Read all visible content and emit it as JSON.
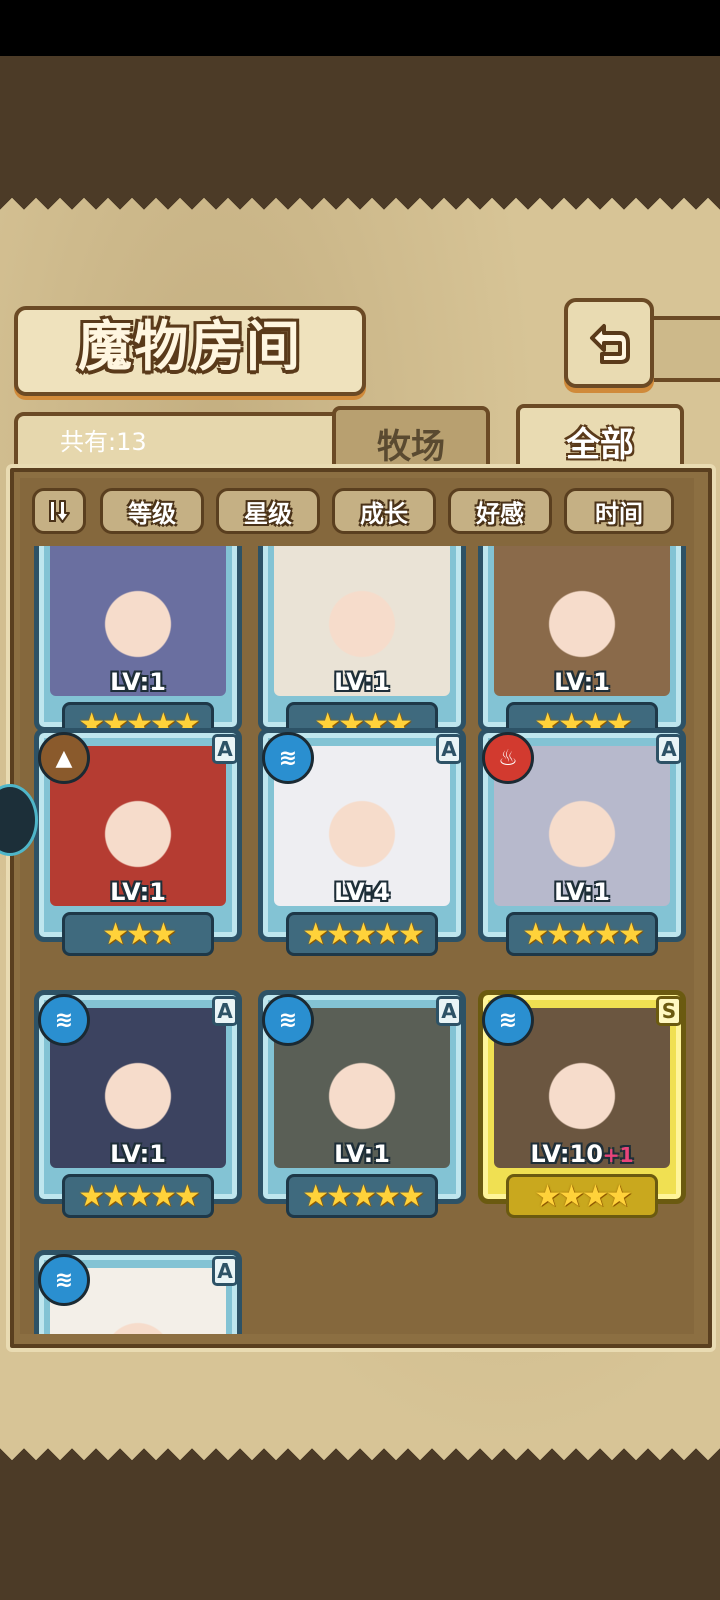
{
  "header": {
    "title": "魔物房间",
    "back_icon": "back-arrow-icon"
  },
  "summary": {
    "count_label": "共有:13"
  },
  "tabs": [
    {
      "label": "牧场",
      "active": false
    },
    {
      "label": "全部",
      "active": true
    }
  ],
  "sort_bar": {
    "toggle_icon": "sort-order-icon",
    "options": [
      "等级",
      "星级",
      "成长",
      "好感",
      "时间"
    ]
  },
  "monsters": [
    {
      "level": "LV:1",
      "stars": "★★★★★",
      "element": "",
      "rank": "",
      "frame": "blue",
      "portrait_color": "#6a6fa0"
    },
    {
      "level": "LV:1",
      "stars": "★★★★",
      "element": "",
      "rank": "",
      "frame": "blue",
      "portrait_color": "#eae3d6"
    },
    {
      "level": "LV:1",
      "stars": "★★★★",
      "element": "",
      "rank": "",
      "frame": "blue",
      "portrait_color": "#8a6a4a"
    },
    {
      "level": "LV:1",
      "stars": "★★★",
      "element": "earth",
      "rank": "A",
      "frame": "blue",
      "portrait_color": "#b53c32"
    },
    {
      "level": "LV:4",
      "stars": "★★★★★",
      "element": "water",
      "rank": "A",
      "frame": "blue",
      "portrait_color": "#eeeef2"
    },
    {
      "level": "LV:1",
      "stars": "★★★★★",
      "element": "fire",
      "rank": "A",
      "frame": "blue",
      "portrait_color": "#b7b9cc"
    },
    {
      "level": "LV:1",
      "stars": "★★★★★",
      "element": "water",
      "rank": "A",
      "frame": "blue",
      "portrait_color": "#3c4360"
    },
    {
      "level": "LV:1",
      "stars": "★★★★★",
      "element": "water",
      "rank": "A",
      "frame": "blue",
      "portrait_color": "#5a5f56"
    },
    {
      "level": "LV:10",
      "level_bonus": "+1",
      "stars": "★★★★",
      "element": "water",
      "rank": "S",
      "frame": "gold",
      "portrait_color": "#6b5640"
    },
    {
      "level": "",
      "stars": "",
      "element": "water",
      "rank": "A",
      "frame": "blue",
      "portrait_color": "#f3efe8"
    }
  ],
  "colors": {
    "parchment": "#d7c496",
    "frame_brown": "#6b4a25",
    "frame_blue": "#83c3d4",
    "frame_gold": "#f0e052",
    "star": "#ffd23a",
    "water": "#2a8fd0",
    "fire": "#d23a2f",
    "earth": "#8a5a2c"
  }
}
